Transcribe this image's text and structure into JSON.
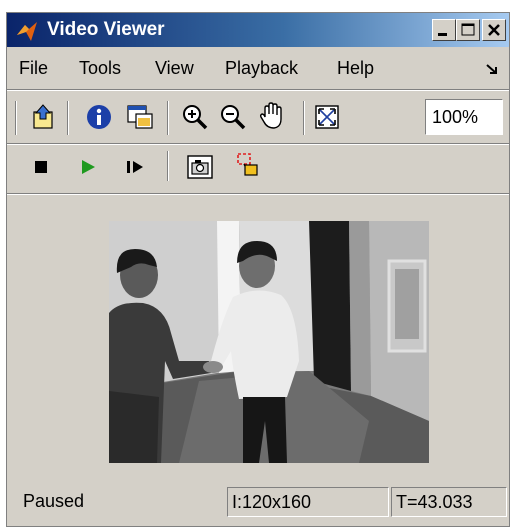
{
  "window": {
    "title": "Video Viewer",
    "title_buttons": [
      "minimize",
      "maximize",
      "close"
    ]
  },
  "menu": [
    "File",
    "Tools",
    "View",
    "Playback",
    "Help"
  ],
  "toolbar": {
    "tools": [
      "open-file-icon",
      "info-icon",
      "new-window-icon",
      "zoom-in-icon",
      "zoom-out-icon",
      "pan-hand-icon",
      "fit-to-window-icon"
    ],
    "zoom_value": "100%"
  },
  "playback_toolbar": {
    "tools": [
      "stop-icon",
      "play-icon",
      "step-forward-icon",
      "snapshot-camera-icon",
      "highlight-icon"
    ]
  },
  "status": {
    "state": "Paused",
    "image_size": "I:120x160",
    "time": "T=43.033"
  },
  "colors": {
    "play": "#1f9a1f",
    "titlebar_start": "#0a246a",
    "titlebar_end": "#a6caf0",
    "face": "#d4d0c8"
  }
}
